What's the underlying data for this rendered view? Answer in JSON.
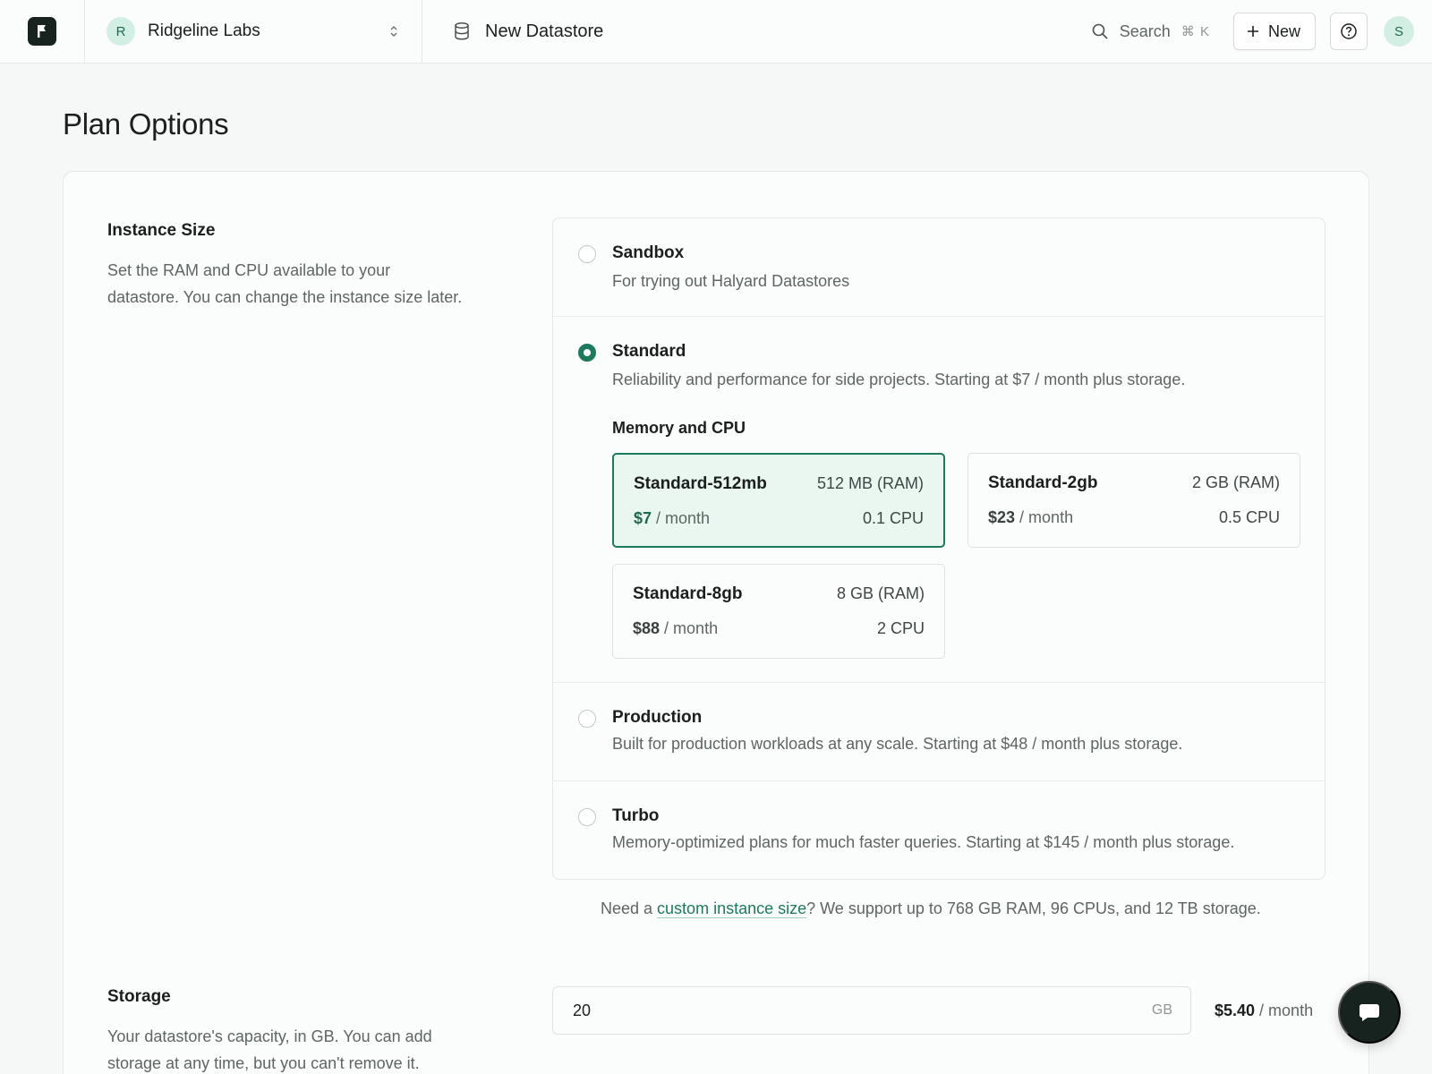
{
  "header": {
    "org": {
      "initial": "R",
      "name": "Ridgeline Labs"
    },
    "breadcrumb": "New Datastore",
    "search": {
      "label": "Search",
      "shortcut": "⌘ K"
    },
    "new_label": "New",
    "user_initial": "S"
  },
  "page_title": "Plan Options",
  "instance_size": {
    "title": "Instance Size",
    "description": "Set the RAM and CPU available to your datastore. You can change the instance size later.",
    "plans": [
      {
        "name": "Sandbox",
        "description": "For trying out Halyard Datastores",
        "selected": false
      },
      {
        "name": "Standard",
        "description": "Reliability and performance for side projects. Starting at $7 / month plus storage.",
        "selected": true
      },
      {
        "name": "Production",
        "description": "Built for production workloads at any scale. Starting at $48 / month plus storage.",
        "selected": false
      },
      {
        "name": "Turbo",
        "description": "Memory-optimized plans for much faster queries. Starting at $145 / month plus storage.",
        "selected": false
      }
    ],
    "memory_cpu_title": "Memory and CPU",
    "tiers": [
      {
        "name": "Standard-512mb",
        "ram": "512 MB (RAM)",
        "price": "$7",
        "period": " / month",
        "cpu": "0.1 CPU",
        "selected": true
      },
      {
        "name": "Standard-2gb",
        "ram": "2 GB (RAM)",
        "price": "$23",
        "period": " / month",
        "cpu": "0.5 CPU",
        "selected": false
      },
      {
        "name": "Standard-8gb",
        "ram": "8 GB (RAM)",
        "price": "$88",
        "period": " / month",
        "cpu": "2 CPU",
        "selected": false
      }
    ],
    "custom_note": {
      "before": "Need a ",
      "link": "custom instance size",
      "after": "? We support up to 768 GB RAM, 96 CPUs, and 12 TB storage."
    }
  },
  "storage": {
    "title": "Storage",
    "description": "Your datastore's capacity, in GB. You can add storage at any time, but you can't remove it.",
    "value": "20",
    "unit": "GB",
    "price": "$5.40",
    "period": " / month"
  },
  "colors": {
    "accent": "#1d7a5e",
    "selected_bg": "#e9f7f0",
    "dark": "#16231f"
  },
  "icons": {
    "logo": "flag-icon",
    "org_switch": "chevron-up-down-icon",
    "breadcrumb": "database-icon",
    "search": "search-icon",
    "new": "plus-icon",
    "help": "help-icon",
    "chat": "chat-icon"
  }
}
